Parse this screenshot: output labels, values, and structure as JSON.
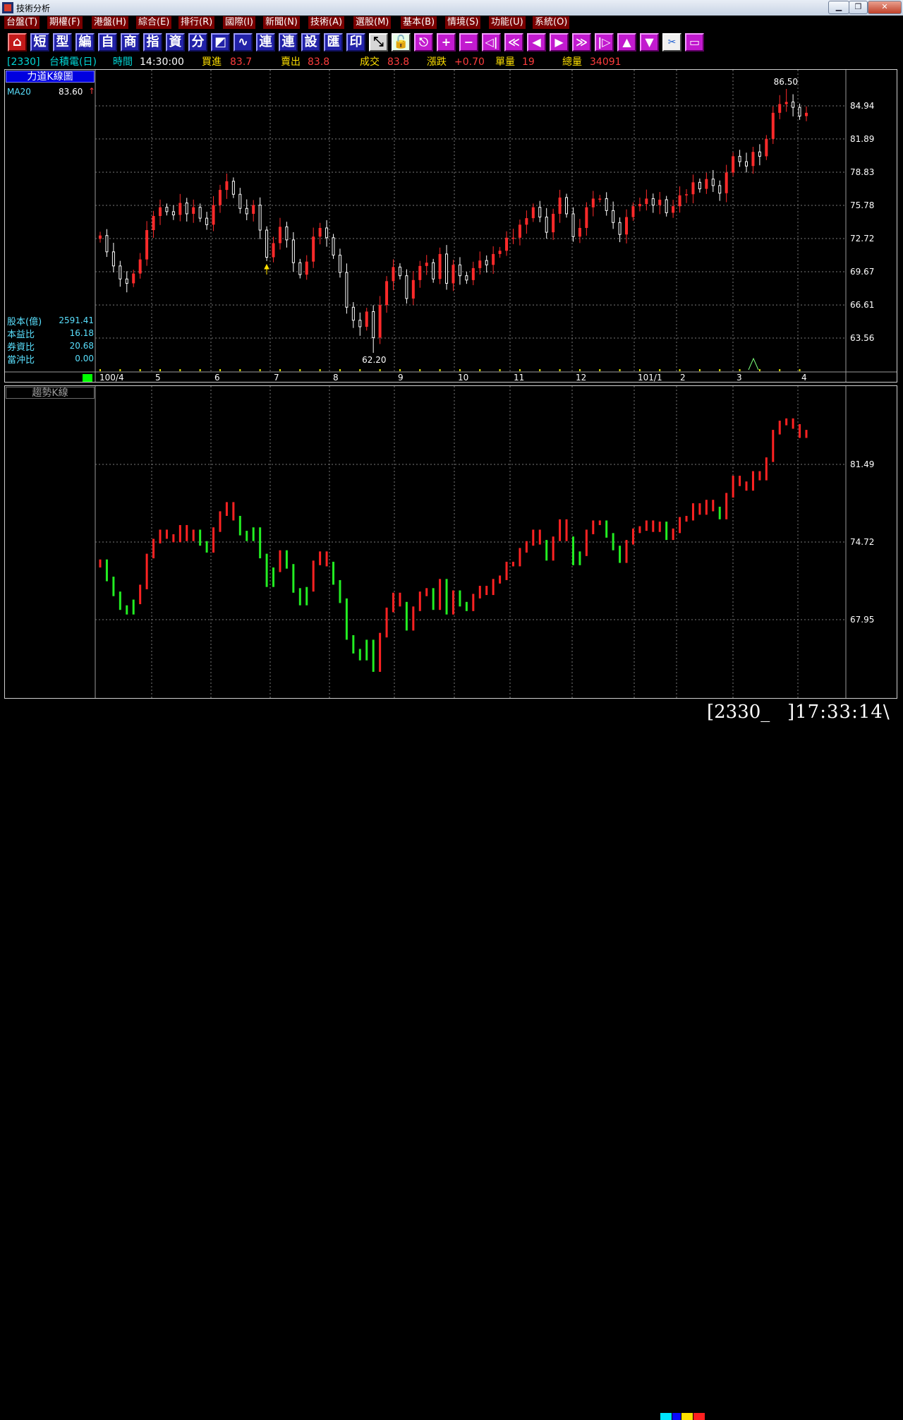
{
  "window": {
    "title": "技術分析",
    "minimize": "▁",
    "restore": "❐",
    "close": "✕"
  },
  "menu": [
    "台盤(T)",
    "期權(F)",
    "港盤(H)",
    "綜合(E)",
    "排行(R)",
    "國際(I)",
    "新聞(N)",
    "技術(A)",
    "選股(M)",
    "基本(B)",
    "情境(S)",
    "功能(U)",
    "系統(O)"
  ],
  "toolbar": {
    "buttons": [
      {
        "label": "⌂",
        "icon": "home-icon",
        "style": "red"
      },
      {
        "label": "短"
      },
      {
        "label": "型"
      },
      {
        "label": "編"
      },
      {
        "label": "自"
      },
      {
        "label": "商"
      },
      {
        "label": "指"
      },
      {
        "label": "資"
      },
      {
        "label": "分"
      },
      {
        "label": "◩",
        "icon": "layout-icon"
      },
      {
        "label": "∿",
        "icon": "chart-icon"
      },
      {
        "label": "連"
      },
      {
        "label": "連"
      },
      {
        "label": "設"
      },
      {
        "label": "匯"
      },
      {
        "label": "印"
      },
      {
        "label": "⤡",
        "icon": "cursor-icon",
        "style": "gray"
      },
      {
        "label": "🔓",
        "icon": "lock-icon",
        "style": "green"
      },
      {
        "label": "⎋",
        "icon": "esc-icon",
        "style": "mag"
      },
      {
        "label": "+",
        "icon": "zoom-in-icon",
        "style": "mag"
      },
      {
        "label": "−",
        "icon": "zoom-out-icon",
        "style": "mag"
      },
      {
        "label": "◁|",
        "icon": "first-icon",
        "style": "mag"
      },
      {
        "label": "≪",
        "icon": "rewind-icon",
        "style": "mag"
      },
      {
        "label": "◀",
        "icon": "prev-icon",
        "style": "mag"
      },
      {
        "label": "▶",
        "icon": "next-icon",
        "style": "mag"
      },
      {
        "label": "≫",
        "icon": "forward-icon",
        "style": "mag"
      },
      {
        "label": "|▷",
        "icon": "last-icon",
        "style": "mag"
      },
      {
        "label": "▲",
        "icon": "up-icon",
        "style": "mag"
      },
      {
        "label": "▼",
        "icon": "down-icon",
        "style": "mag"
      },
      {
        "label": "✂",
        "icon": "tools-icon",
        "style": "white"
      },
      {
        "label": "▭",
        "icon": "window-icon",
        "style": "mag"
      }
    ]
  },
  "quote": {
    "code": "[2330]",
    "name": "台積電(日)",
    "time_label": "時間",
    "time": "14:30:00",
    "bid_label": "買進",
    "bid": "83.7",
    "ask_label": "賣出",
    "ask": "83.8",
    "last_label": "成交",
    "last": "83.8",
    "change_label": "漲跌",
    "change": "+0.70",
    "vol_label": "單量",
    "vol": "19",
    "total_label": "總量",
    "total": "34091"
  },
  "upper": {
    "title": "力道K線圖",
    "ma_label": "MA20",
    "ma_value": "83.60",
    "ma_arrow": "↑",
    "fundamentals": [
      {
        "label": "股本(億)",
        "value": "2591.41"
      },
      {
        "label": "本益比",
        "value": "16.18"
      },
      {
        "label": "券資比",
        "value": "20.68"
      },
      {
        "label": "當沖比",
        "value": "0.00"
      }
    ],
    "y_labels": [
      "84.94",
      "81.89",
      "78.83",
      "75.78",
      "72.72",
      "69.67",
      "66.61",
      "63.56"
    ],
    "x_labels": [
      "100/4",
      "5",
      "6",
      "7",
      "8",
      "9",
      "10",
      "11",
      "12",
      "101/1",
      "2",
      "3",
      "4"
    ],
    "high_label": "86.50",
    "low_label": "62.20"
  },
  "lower": {
    "title": "趨勢K線",
    "y_labels": [
      "81.49",
      "74.72",
      "67.95"
    ]
  },
  "status": {
    "code": "[2330_",
    "time": "]17:33:14\\"
  },
  "chart_data": {
    "type": "candlestick",
    "symbol": "2330",
    "period": "daily",
    "x_range": [
      "100/4",
      "101/4"
    ],
    "y_axis_upper": [
      84.94,
      81.89,
      78.83,
      75.78,
      72.72,
      69.67,
      66.61,
      63.56
    ],
    "y_axis_lower": [
      81.49,
      74.72,
      67.95
    ],
    "closes": [
      73.0,
      71.5,
      70.2,
      69.0,
      68.6,
      69.5,
      70.8,
      73.5,
      74.8,
      75.6,
      75.2,
      74.9,
      76.0,
      75.0,
      75.6,
      74.6,
      74.0,
      75.8,
      77.2,
      78.0,
      76.8,
      75.5,
      75.0,
      75.8,
      73.5,
      71.0,
      72.3,
      73.8,
      72.6,
      70.5,
      69.4,
      70.6,
      72.9,
      73.7,
      72.8,
      71.2,
      69.6,
      66.4,
      65.2,
      64.6,
      66.0,
      63.6,
      66.6,
      68.8,
      70.1,
      69.3,
      67.2,
      68.9,
      70.2,
      70.5,
      69.0,
      71.3,
      68.6,
      70.3,
      69.3,
      68.9,
      70.0,
      70.7,
      70.3,
      71.3,
      71.6,
      72.8,
      72.8,
      74.0,
      74.6,
      75.6,
      74.7,
      73.3,
      75.0,
      76.5,
      75.0,
      72.9,
      73.7,
      75.6,
      76.4,
      76.4,
      75.3,
      74.2,
      73.1,
      74.7,
      75.7,
      75.9,
      76.4,
      75.8,
      76.3,
      75.1,
      75.7,
      76.7,
      76.8,
      77.9,
      77.3,
      78.2,
      77.6,
      76.9,
      78.8,
      80.3,
      79.8,
      79.4,
      80.7,
      80.3,
      81.9,
      84.3,
      85.1,
      85.3,
      84.8,
      84.0,
      84.3
    ],
    "high": 86.5,
    "low": 62.2,
    "ma20_last": 83.6
  }
}
